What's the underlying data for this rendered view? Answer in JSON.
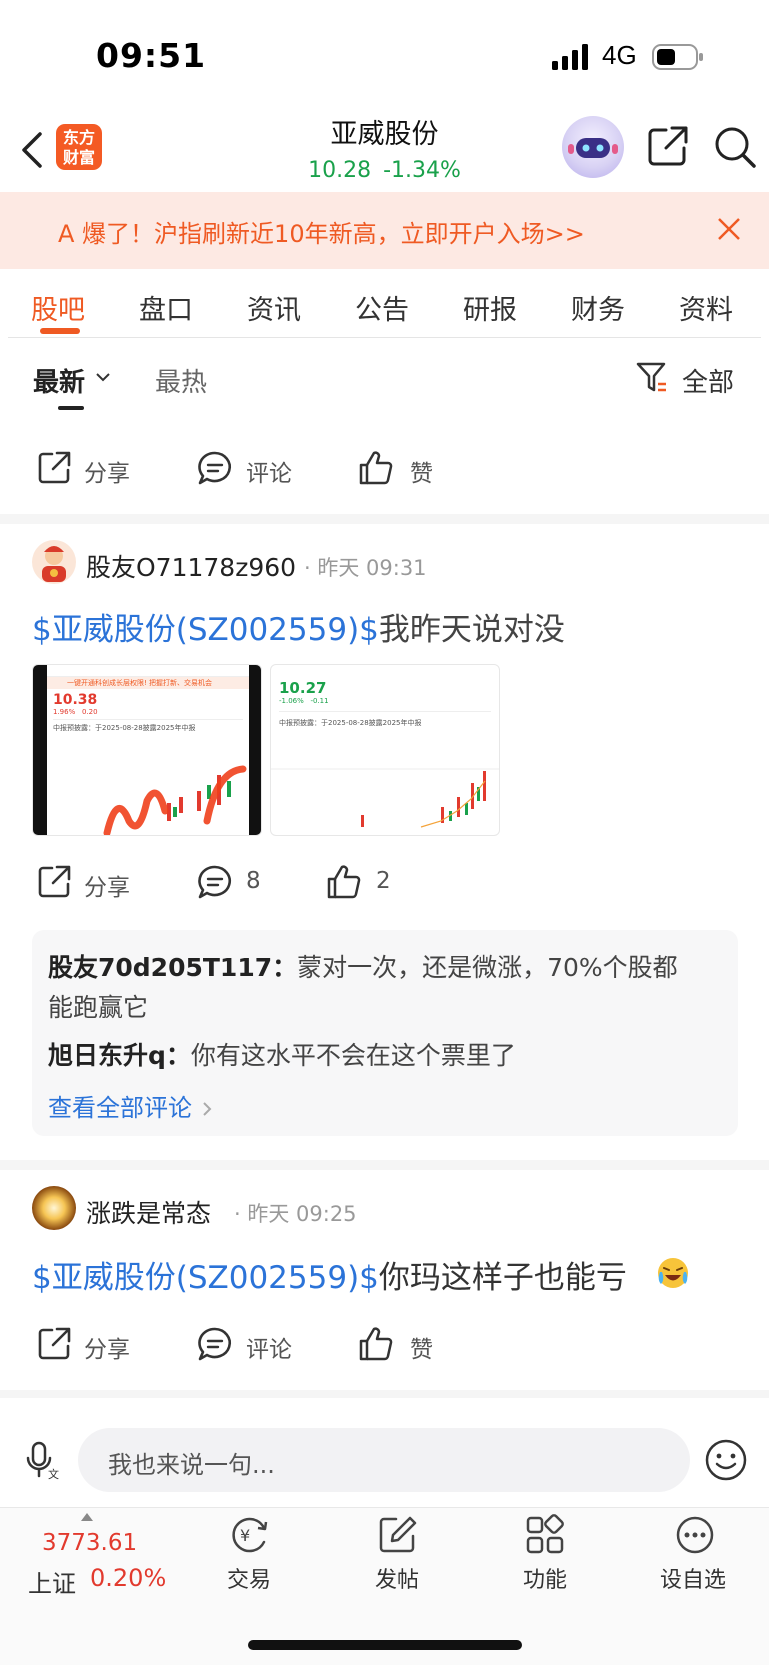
{
  "status_bar": {
    "time": "09:51",
    "network": "4G"
  },
  "header": {
    "logo_line1": "东方",
    "logo_line2": "财富",
    "title": "亚威股份",
    "price": "10.28",
    "change": "-1.34%",
    "icons": [
      "back-icon",
      "robot-assistant",
      "share-icon",
      "search-icon"
    ]
  },
  "banner": {
    "text": "A 爆了！沪指刷新近10年新高，立即开户入场>>"
  },
  "tabs": [
    {
      "label": "股吧",
      "active": true
    },
    {
      "label": "盘口"
    },
    {
      "label": "资讯"
    },
    {
      "label": "公告"
    },
    {
      "label": "研报"
    },
    {
      "label": "财务"
    },
    {
      "label": "资料"
    }
  ],
  "sort": {
    "latest": "最新",
    "hot": "最热",
    "filter": "全部"
  },
  "top_actions": {
    "share": "分享",
    "comment": "评论",
    "like": "赞"
  },
  "posts": [
    {
      "user": "股友O71178z960",
      "time": "· 昨天 09:31",
      "tag": "$亚威股份(SZ002559)$",
      "text": "我昨天说对没",
      "actions": {
        "share": "分享",
        "comment": "8",
        "like": "2"
      },
      "images": [
        {
          "price": "10.38",
          "change": "1.96%",
          "change_abs": "0.20",
          "notice": "中报预披露：于2025-08-28披露2025年中报",
          "banner": "一键开通科创成长层权限! 把握打新、交易机会"
        },
        {
          "price": "10.27",
          "change": "-1.06%",
          "change_abs": "-0.11",
          "notice": "中报预披露：于2025-08-28披露2025年中报"
        }
      ],
      "comments": [
        {
          "user": "股友70d205T117：",
          "text": "蒙对一次，还是微涨，70%个股都",
          "text2": "能跑赢它"
        },
        {
          "user": "旭日东升q：",
          "text": "你有这水平不会在这个票里了"
        }
      ],
      "see_all": "查看全部评论"
    },
    {
      "user": "涨跌是常态",
      "time": "· 昨天 09:25",
      "tag": "$亚威股份(SZ002559)$",
      "text": "你玛这样子也能亏",
      "actions": {
        "share": "分享",
        "comment": "评论",
        "like": "赞"
      }
    }
  ],
  "input": {
    "placeholder": "我也来说一句..."
  },
  "bottom_bar": {
    "index_value": "3773.61",
    "index_name": "上证",
    "index_change": "0.20%",
    "items": [
      "交易",
      "发帖",
      "功能",
      "设自选"
    ]
  },
  "colors": {
    "accent": "#ef5a23",
    "up": "#e23a2e",
    "down": "#1aa14b",
    "link": "#2b73d8"
  }
}
